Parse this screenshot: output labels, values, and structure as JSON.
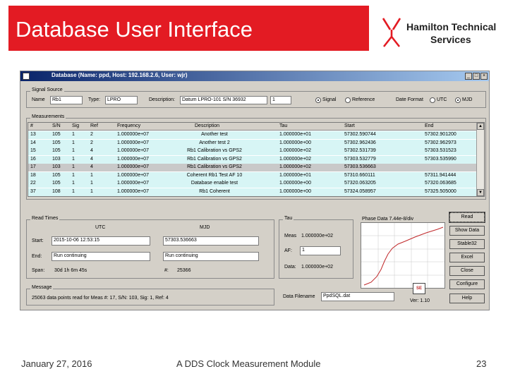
{
  "slide": {
    "title": "Database User Interface",
    "logo": {
      "line1": "Hamilton Technical",
      "line2": "Services"
    },
    "footer": {
      "date": "January 27, 2016",
      "center": "A DDS Clock Measurement Module",
      "page": "23"
    }
  },
  "window": {
    "title": "Database (Name: ppd, Host: 192.168.2.6, User: wjr)",
    "signal_source": {
      "label": "Signal Source",
      "name_label": "Name",
      "name_value": "Rb1",
      "type_label": "Type:",
      "type_value": "LPRO",
      "desc_label": "Description:",
      "desc_value": "Datum LPRO-101 S/N 36932",
      "spin_value": "1",
      "signal_label": "Signal",
      "reference_label": "Reference",
      "date_format_label": "Date Format",
      "utc_label": "UTC",
      "mjd_label": "MJD"
    },
    "measurements": {
      "label": "Measurements",
      "headers": [
        "#",
        "S/N",
        "Sig",
        "Ref",
        "Frequency",
        "Description",
        "Tau",
        "Start",
        "End"
      ],
      "rows": [
        [
          "13",
          "105",
          "1",
          "2",
          "1.000000e+07",
          "Another test",
          "1.000000e+01",
          "57302.590744",
          "57302.901200"
        ],
        [
          "14",
          "105",
          "1",
          "2",
          "1.000000e+07",
          "Another test 2",
          "1.000000e+00",
          "57302.962436",
          "57302.962973"
        ],
        [
          "15",
          "105",
          "1",
          "4",
          "1.000000e+07",
          "Rb1 Calibration vs GPS2",
          "1.000000e+02",
          "57302.531739",
          "57303.531523"
        ],
        [
          "16",
          "103",
          "1",
          "4",
          "1.000000e+07",
          "Rb1 Calibration vs GPS2",
          "1.000000e+02",
          "57303.532779",
          "57303.535990"
        ],
        [
          "17",
          "103",
          "1",
          "4",
          "1.000000e+07",
          "Rb1 Calibration vs GPS2",
          "1.000000e+02",
          "57303.536663",
          ""
        ],
        [
          "18",
          "105",
          "1",
          "1",
          "1.000000e+07",
          "Coherent Rb1 Test AF 10",
          "1.000000e+01",
          "57310.660111",
          "57311.941444"
        ],
        [
          "22",
          "105",
          "1",
          "1",
          "1.000000e+07",
          "Database enable test",
          "1.000000e+00",
          "57320.063205",
          "57320.063685"
        ],
        [
          "37",
          "108",
          "1",
          "1",
          "1.000000e+07",
          "Rb1 Coherent",
          "1.000000e+00",
          "57324.058957",
          "57325.505000"
        ]
      ]
    },
    "read_times": {
      "label": "Read Times",
      "utc_header": "UTC",
      "mjd_header": "MJD",
      "start_label": "Start:",
      "start_utc": "2015-10-06 12:53:15",
      "start_mjd": "57303.536663",
      "end_label": "End:",
      "end_utc": "Run continuing",
      "end_mjd": "Run continuing",
      "span_label": "Span:",
      "span_value": "30d 1h 6m 45s",
      "count_label": "#:",
      "count_value": "25366"
    },
    "tau": {
      "label": "Tau",
      "meas_label": "Meas",
      "meas_value": "1.000000e+02",
      "af_label": "AF:",
      "af_value": "1",
      "data_label": "Data:",
      "data_value": "1.000000e+02"
    },
    "phase_plot": {
      "title": "Phase Data 7.44e-8/div"
    },
    "buttons": [
      "Read",
      "Show Data",
      "Stable32",
      "Excel",
      "Close",
      "Configure",
      "Help"
    ],
    "message": {
      "label": "Message",
      "text": "25063 data points read for Meas #: 17, S/N: 103, Sig: 1, Ref: 4"
    },
    "data_filename_label": "Data Filename",
    "data_filename_value": "PpdSQL.dat",
    "db_badge": "SE",
    "version": "Ver: 1.10"
  }
}
